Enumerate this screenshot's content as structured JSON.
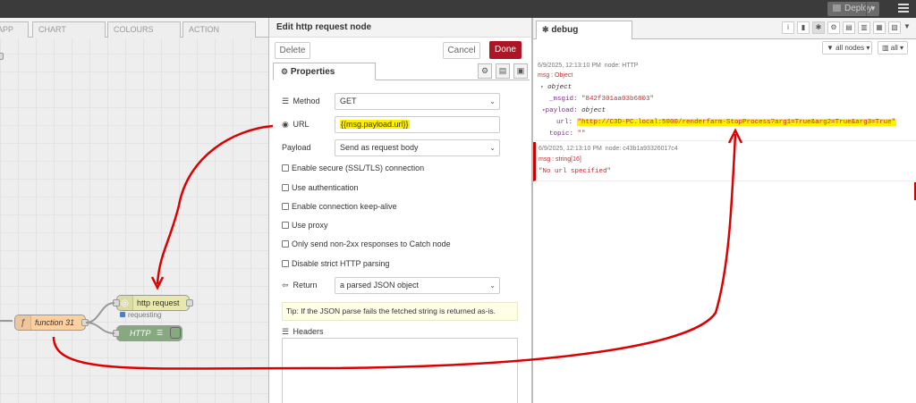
{
  "topbar": {
    "deploy_label": "Deploy"
  },
  "workspace": {
    "tabs": [
      "APP",
      "CHART",
      "COLOURS",
      "ACTION"
    ],
    "nodes": {
      "http_request": {
        "label": "http request",
        "status": "requesting"
      },
      "function": {
        "label": "function 31"
      },
      "http_debug": {
        "label": "HTTP"
      }
    }
  },
  "edit": {
    "title": "Edit http request node",
    "delete_label": "Delete",
    "cancel_label": "Cancel",
    "done_label": "Done",
    "properties_tab": "Properties",
    "method": {
      "label": "Method",
      "value": "GET"
    },
    "url": {
      "label": "URL",
      "value": "{{msg.payload.url}}"
    },
    "payload": {
      "label": "Payload",
      "value": "Send as request body"
    },
    "checkboxes": [
      "Enable secure (SSL/TLS) connection",
      "Use authentication",
      "Enable connection keep-alive",
      "Use proxy",
      "Only send non-2xx responses to Catch node",
      "Disable strict HTTP parsing"
    ],
    "return": {
      "label": "Return",
      "value": "a parsed JSON object"
    },
    "tip": "Tip: If the JSON parse fails the fetched string is returned as-is.",
    "headers_label": "Headers"
  },
  "debug": {
    "tab_label": "debug",
    "filter_nodes": "all nodes",
    "filter_all": "all",
    "messages": [
      {
        "timestamp": "6/9/2025, 12:13:10 PM",
        "node": "node: HTTP",
        "type": "msg : Object",
        "object_label": "object",
        "msgid_key": "_msgid:",
        "msgid_val": "\"842f301aa03b6803\"",
        "payload_key": "payload:",
        "payload_type": "object",
        "url_key": "url:",
        "url_val": "\"http://C3D-PC.local:5000/renderfarm-StopProcess?arg1=True&arg2=True&arg3=True\"",
        "topic_key": "topic:",
        "topic_val": "\"\""
      },
      {
        "timestamp": "6/9/2025, 12:13:10 PM",
        "node": "node: c43b1a93326017c4",
        "type": "msg : string[16]",
        "value": "\"No url specified\""
      }
    ]
  }
}
